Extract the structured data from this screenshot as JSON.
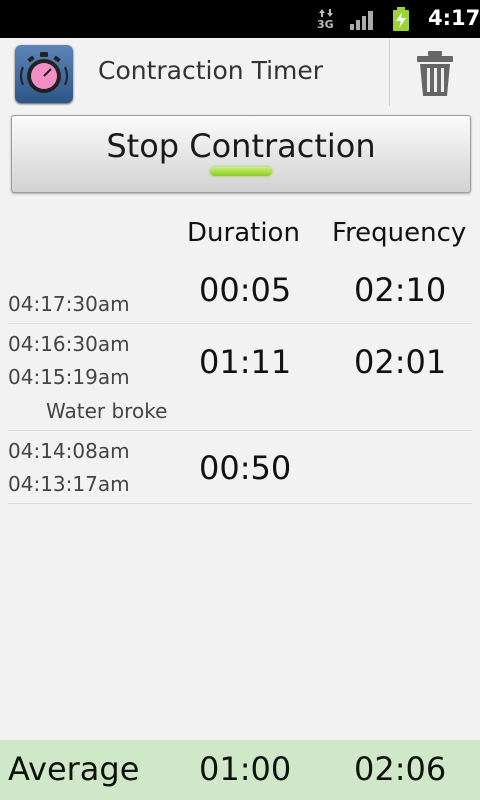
{
  "status_bar": {
    "network": "3G",
    "time": "4:17"
  },
  "title_bar": {
    "app_title": "Contraction Timer",
    "icons": [
      "stopwatch-icon",
      "trash-icon"
    ]
  },
  "stop_button": {
    "label": "Stop Contraction",
    "indicator_color": "#8ccb24"
  },
  "table": {
    "headers": {
      "duration": "Duration",
      "frequency": "Frequency"
    },
    "rows": [
      {
        "start": "04:17:30am",
        "end": "",
        "note": "",
        "duration": "00:05",
        "frequency": "02:10"
      },
      {
        "start": "04:16:30am",
        "end": "04:15:19am",
        "note": "Water broke",
        "duration": "01:11",
        "frequency": "02:01"
      },
      {
        "start": "04:14:08am",
        "end": "04:13:17am",
        "note": "",
        "duration": "00:50",
        "frequency": ""
      }
    ]
  },
  "footer": {
    "label": "Average",
    "duration": "01:00",
    "frequency": "02:06",
    "background": "#cfe9c8"
  }
}
